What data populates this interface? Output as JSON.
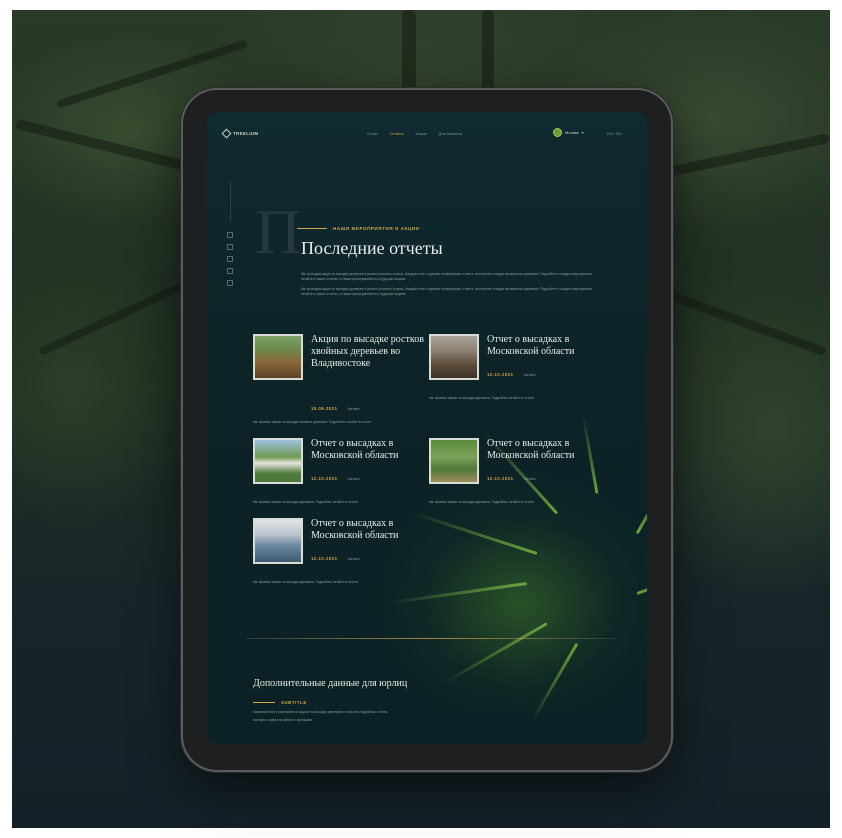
{
  "header": {
    "logo_text": "TREELIUM",
    "nav": [
      "О нас",
      "Отчеты",
      "Акции",
      "Для бизнеса"
    ],
    "nav_active_index": 1,
    "region_label": "Москва",
    "lang_label": "EN / RU"
  },
  "hero": {
    "big_letter": "П",
    "eyebrow": "НАШИ МЕРОПРИЯТИЯ И АКЦИИ",
    "title": "Последние отчеты",
    "paragraphs": [
      "Мы проводим акции по высадке деревьев в разных регионах страны. Каждый отчет содержит информацию о месте, количестве и видах высаженных деревьев. Подробнее о каждом мероприятии читайте в наших отчетах, а также присоединяйтесь к будущим акциям.",
      "Мы проводим акции по высадке деревьев в разных регионах страны. Каждый отчет содержит информацию о месте, количестве и видах высаженных деревьев. Подробнее о каждом мероприятии читайте в наших отчетах, а также присоединяйтесь к будущим акциям."
    ]
  },
  "reports": [
    {
      "title": "Акция по высадке ростков хвойных деревьев во Владивостоке",
      "date": "15.09.2021",
      "more": "Читать",
      "desc": "Мы провели акцию по высадке хвойных деревьев. Подробнее читайте в отчете."
    },
    {
      "title": "Отчет о высадках в Московской области",
      "date": "12.10.2021",
      "more": "Читать",
      "desc": "Мы провели акцию по высадке деревьев. Подробнее читайте в отчете."
    },
    {
      "title": "Отчет о высадках в Московской области",
      "date": "12.10.2021",
      "more": "Читать",
      "desc": "Мы провели акцию по высадке деревьев. Подробнее читайте в отчете."
    },
    {
      "title": "Отчет о высадках в Московской области",
      "date": "12.10.2021",
      "more": "Читать",
      "desc": "Мы провели акцию по высадке деревьев. Подробнее читайте в отчете."
    },
    {
      "title": "Отчет о высадках в Московской области",
      "date": "12.10.2021",
      "more": "Читать",
      "desc": "Мы провели акцию по высадке деревьев. Подробнее читайте в отчете."
    }
  ],
  "extra": {
    "title": "Дополнительные данные для юрлиц",
    "subtitle": "SUBTITLE",
    "paragraphs": [
      "Компании могут участвовать в акциях по высадке деревьев и получать подробные отчеты.",
      "Контакты отдела по работе с юрлицами."
    ]
  },
  "colors": {
    "accent": "#d6a84a",
    "screen_bg": "#0d2328",
    "text": "#e6ece6"
  }
}
